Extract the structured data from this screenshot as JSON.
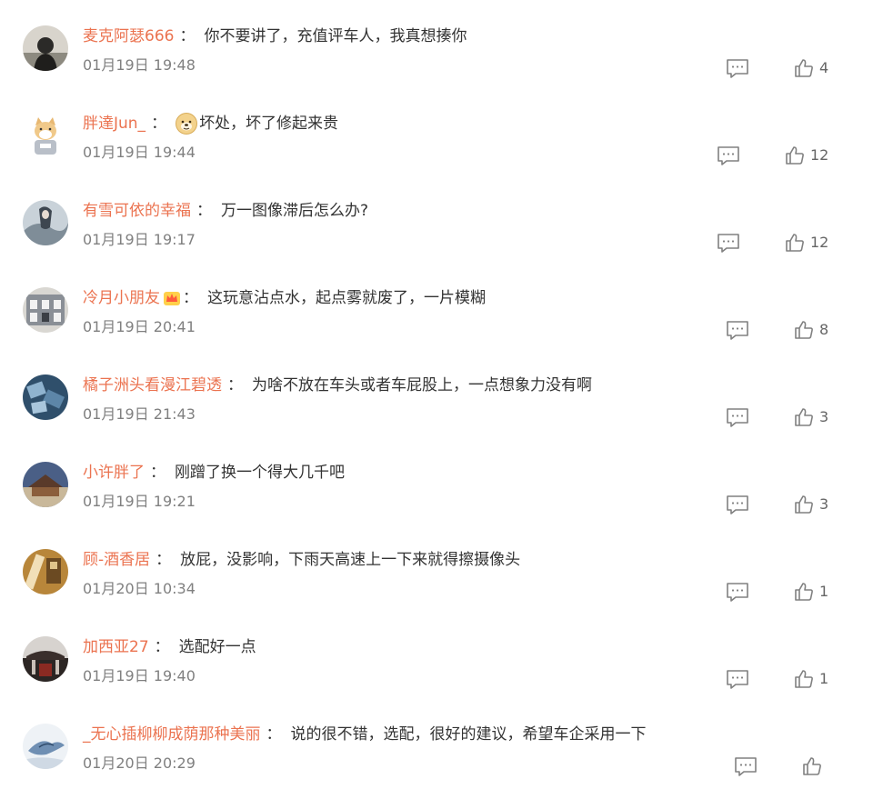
{
  "comments": [
    {
      "user": "麦克阿瑟666",
      "text": "你不要讲了，充值评车人，我真想揍你",
      "time": "01月19日 19:48",
      "likes": "4"
    },
    {
      "user": "胖達Jun_",
      "text": "坏处，坏了修起来贵",
      "time": "01月19日 19:44",
      "likes": "12"
    },
    {
      "user": "有雪可依的幸福",
      "text": "万一图像滞后怎么办?",
      "time": "01月19日 19:17",
      "likes": "12"
    },
    {
      "user": "冷月小朋友",
      "text": "这玩意沾点水，起点雾就废了，一片模糊",
      "time": "01月19日 20:41",
      "likes": "8"
    },
    {
      "user": "橘子洲头看漫江碧透",
      "text": "为啥不放在车头或者车屁股上，一点想象力没有啊",
      "time": "01月19日 21:43",
      "likes": "3"
    },
    {
      "user": "小许胖了",
      "text": "刚蹭了换一个得大几千吧",
      "time": "01月19日 19:21",
      "likes": "3"
    },
    {
      "user": "顾-酒香居",
      "text": "放屁，没影响，下雨天高速上一下来就得擦摄像头",
      "time": "01月20日 10:34",
      "likes": "1"
    },
    {
      "user": "加西亚27",
      "text": "选配好一点",
      "time": "01月19日 19:40",
      "likes": "1"
    },
    {
      "user": "_无心插柳柳成荫那种美丽",
      "text": "说的很不错，选配，很好的建议，希望车企采用一下",
      "time": "01月20日 20:29",
      "likes": ""
    }
  ],
  "separator": "：",
  "colors": {
    "username": "#eb7350",
    "text": "#333333",
    "timestamp": "#808080",
    "icon": "#808080"
  },
  "icons": {
    "reply": "comment-bubble-icon",
    "like": "thumbs-up-icon",
    "emoji": "doge-emoji-icon",
    "badge": "crown-badge-icon"
  }
}
